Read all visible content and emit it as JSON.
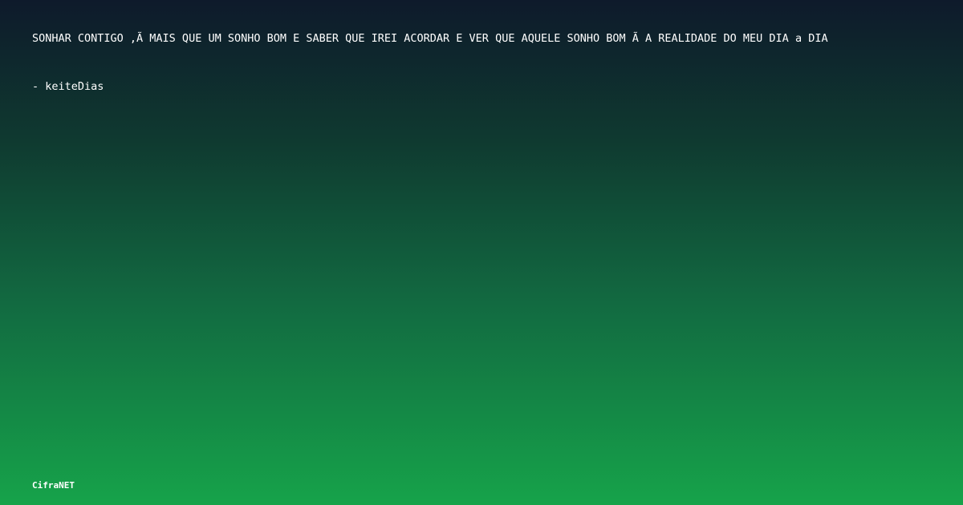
{
  "quote": {
    "text": "SONHAR CONTIGO ‚Ã  MAIS QUE UM SONHO BOM E SABER QUE IREI ACORDAR E VER QUE AQUELE SONHO BOM Ã  A REALIDADE DO MEU DIA a DIA"
  },
  "author": {
    "text": "- keiteDias"
  },
  "brand": {
    "text": "CifraNET"
  },
  "colors": {
    "background_top": "#0e1a2b",
    "background_bottom": "#16a34a",
    "text": "#ffffff"
  }
}
